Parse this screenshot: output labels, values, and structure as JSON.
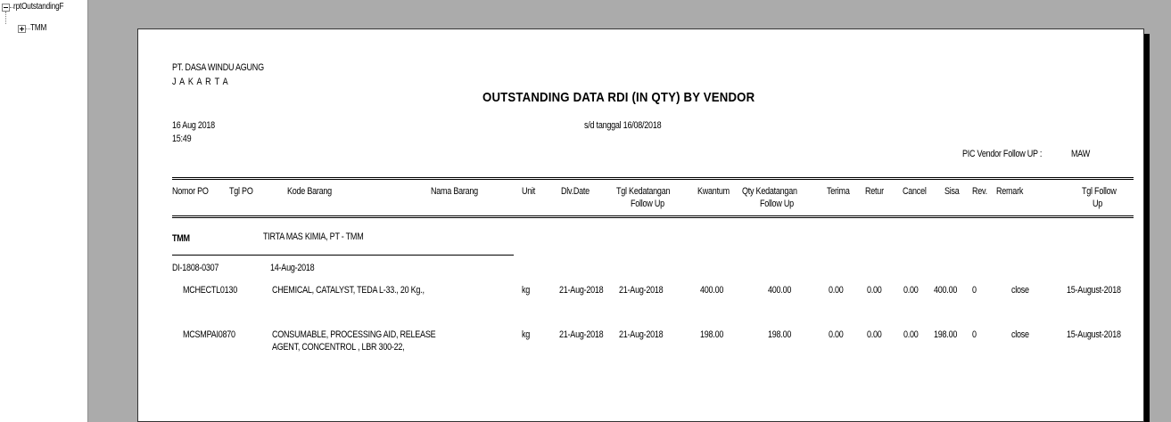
{
  "tree": {
    "root_label": "rptOutstandingF",
    "child_label": "TMM"
  },
  "report": {
    "company": "PT. DASA WINDU AGUNG",
    "city": "J A K A R T A",
    "title": "OUTSTANDING DATA RDI (IN QTY) BY VENDOR",
    "print_date": "16 Aug 2018",
    "print_time": "15:49",
    "date_filter": "s/d tanggal 16/08/2018",
    "pic_label": "PIC Vendor Follow UP :",
    "pic_value": "MAW",
    "columns": {
      "nomor_po": "Nomor PO",
      "tgl_po": "Tgl PO",
      "kode_barang": "Kode Barang",
      "nama_barang": "Nama Barang",
      "unit": "Unit",
      "dlv_date": "Dlv.Date",
      "tgl_kedatangan_1": "Tgl Kedatangan",
      "tgl_kedatangan_2": "Follow Up",
      "kwantum": "Kwantum",
      "qty_kedatangan_1": "Qty Kedatangan",
      "qty_kedatangan_2": "Follow Up",
      "terima": "Terima",
      "retur": "Retur",
      "cancel": "Cancel",
      "sisa": "Sisa",
      "rev": "Rev.",
      "remark": "Remark",
      "tgl_follow_1": "Tgl Follow",
      "tgl_follow_2": "Up"
    },
    "vendor": {
      "code": "TMM",
      "name": "TIRTA MAS KIMIA, PT - TMM"
    },
    "po": {
      "number": "DI-1808-0307",
      "date": "14-Aug-2018"
    },
    "rows": [
      {
        "kode": "MCHECTL0130",
        "nama_1": "CHEMICAL, CATALYST,   TEDA L-33., 20 Kg.,",
        "nama_2": "",
        "unit": "kg",
        "dlv_date": "21-Aug-2018",
        "tgl_kedatangan": "21-Aug-2018",
        "kwantum": "400.00",
        "qty_kedatangan": "400.00",
        "terima": "0.00",
        "retur": "0.00",
        "cancel": "0.00",
        "sisa": "400.00",
        "rev": "0",
        "remark": "close",
        "tgl_follow": "15-August-2018"
      },
      {
        "kode": "MCSMPAI0870",
        "nama_1": "CONSUMABLE, PROCESSING AID, RELEASE",
        "nama_2": "AGENT, CONCENTROL , LBR 300-22,",
        "unit": "kg",
        "dlv_date": "21-Aug-2018",
        "tgl_kedatangan": "21-Aug-2018",
        "kwantum": "198.00",
        "qty_kedatangan": "198.00",
        "terima": "0.00",
        "retur": "0.00",
        "cancel": "0.00",
        "sisa": "198.00",
        "rev": "0",
        "remark": "close",
        "tgl_follow": "15-August-2018"
      }
    ]
  }
}
